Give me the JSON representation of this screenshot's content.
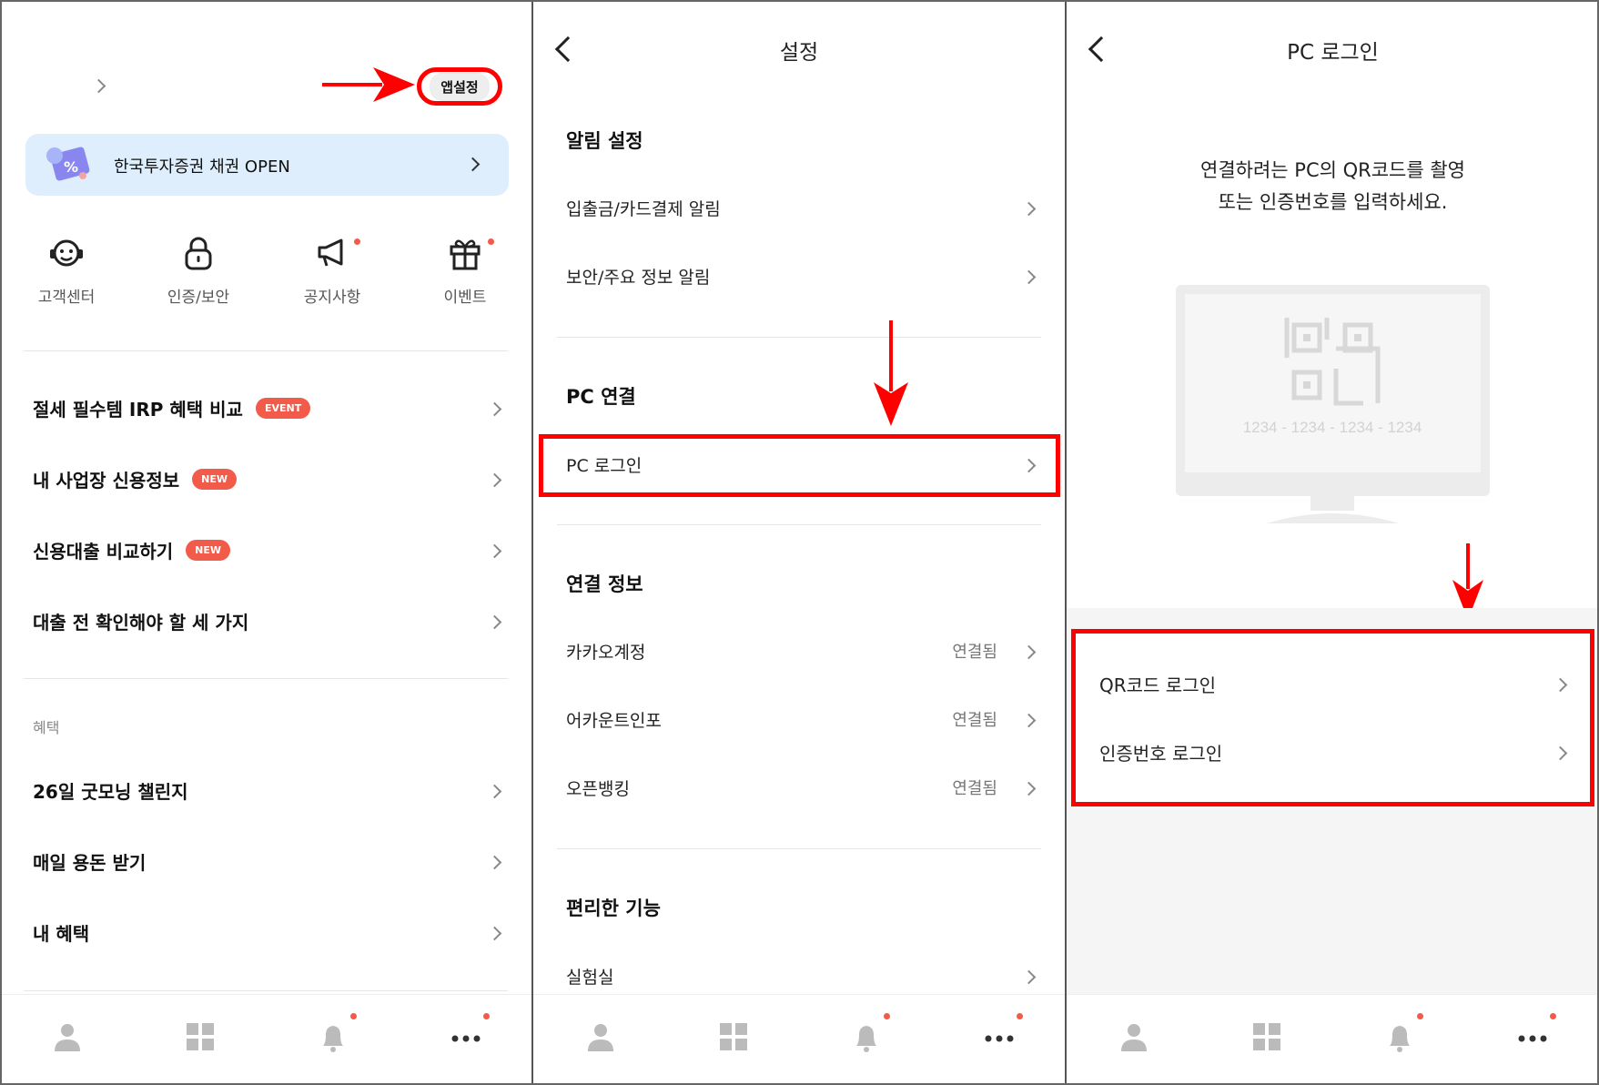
{
  "panel1": {
    "app_settings_label": "앱설정",
    "banner_label": "한국투자증권 채권 OPEN",
    "quick_actions": [
      {
        "label": "고객센터",
        "icon": "headset-smile-icon"
      },
      {
        "label": "인증/보안",
        "icon": "lock-icon"
      },
      {
        "label": "공지사항",
        "icon": "megaphone-icon"
      },
      {
        "label": "이벤트",
        "icon": "gift-icon"
      }
    ],
    "menu_items": [
      {
        "label": "절세 필수템 IRP 혜택 비교",
        "badge": "EVENT"
      },
      {
        "label": "내 사업장 신용정보",
        "badge": "NEW"
      },
      {
        "label": "신용대출 비교하기",
        "badge": "NEW"
      },
      {
        "label": "대출 전 확인해야 할 세 가지",
        "badge": ""
      }
    ],
    "section_label": "혜택",
    "benefit_items": [
      {
        "label": "26일 굿모닝 챌린지"
      },
      {
        "label": "매일 용돈 받기"
      },
      {
        "label": "내 혜택"
      }
    ]
  },
  "panel2": {
    "title": "설정",
    "sections": [
      {
        "header": "알림 설정",
        "rows": [
          {
            "label": "입출금/카드결제 알림",
            "status": ""
          },
          {
            "label": "보안/주요 정보 알림",
            "status": ""
          }
        ]
      },
      {
        "header": "PC 연결",
        "rows": [
          {
            "label": "PC 로그인",
            "status": ""
          }
        ]
      },
      {
        "header": "연결 정보",
        "rows": [
          {
            "label": "카카오계정",
            "status": "연결됨"
          },
          {
            "label": "어카운트인포",
            "status": "연결됨"
          },
          {
            "label": "오픈뱅킹",
            "status": "연결됨"
          }
        ]
      },
      {
        "header": "편리한 기능",
        "rows": [
          {
            "label": "실험실",
            "status": ""
          }
        ]
      }
    ]
  },
  "panel3": {
    "title": "PC 로그인",
    "instruction_line1": "연결하려는 PC의 QR코드를 촬영",
    "instruction_line2": "또는 인증번호를 입력하세요.",
    "monitor_code": "1234 - 1234 - 1234 - 1234",
    "options": [
      {
        "label": "QR코드 로그인"
      },
      {
        "label": "인증번호 로그인"
      }
    ]
  },
  "tabbar": {
    "tabs": [
      {
        "icon": "person-icon"
      },
      {
        "icon": "grid-icon"
      },
      {
        "icon": "bell-icon"
      },
      {
        "icon": "more-icon"
      }
    ]
  },
  "colors": {
    "accent_red": "#ff0000",
    "badge_red": "#f25a4a",
    "banner_bg": "#dfeefc"
  }
}
